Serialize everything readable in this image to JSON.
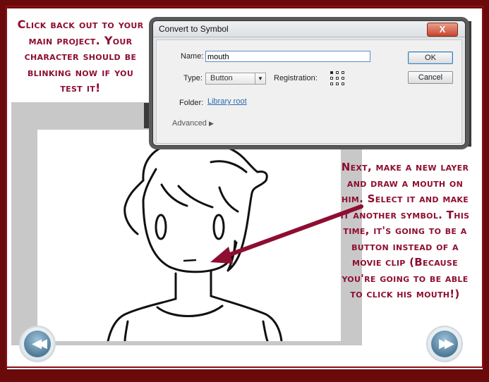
{
  "instructions": {
    "top_note": "Click back out to your main project. Your character should be blinking now if you test it!",
    "right_note": "Next, make a new layer and draw a mouth on him. Select it and make it another symbol. This time, it's going to be a button instead of a movie clip (Because you're going to be able to click his mouth!)"
  },
  "dialog": {
    "title": "Convert to Symbol",
    "close_label": "X",
    "name_label": "Name:",
    "name_value": "mouth",
    "type_label": "Type:",
    "type_value": "Button",
    "registration_label": "Registration:",
    "folder_label": "Folder:",
    "folder_value": "Library root",
    "advanced_label": "Advanced",
    "ok_label": "OK",
    "cancel_label": "Cancel"
  },
  "navigation": {
    "prev_icon": "rewind-icon",
    "next_icon": "fast-forward-icon"
  },
  "colors": {
    "border": "#6b0a0a",
    "note_text": "#8e0e31",
    "arrow": "#8e0e31"
  }
}
